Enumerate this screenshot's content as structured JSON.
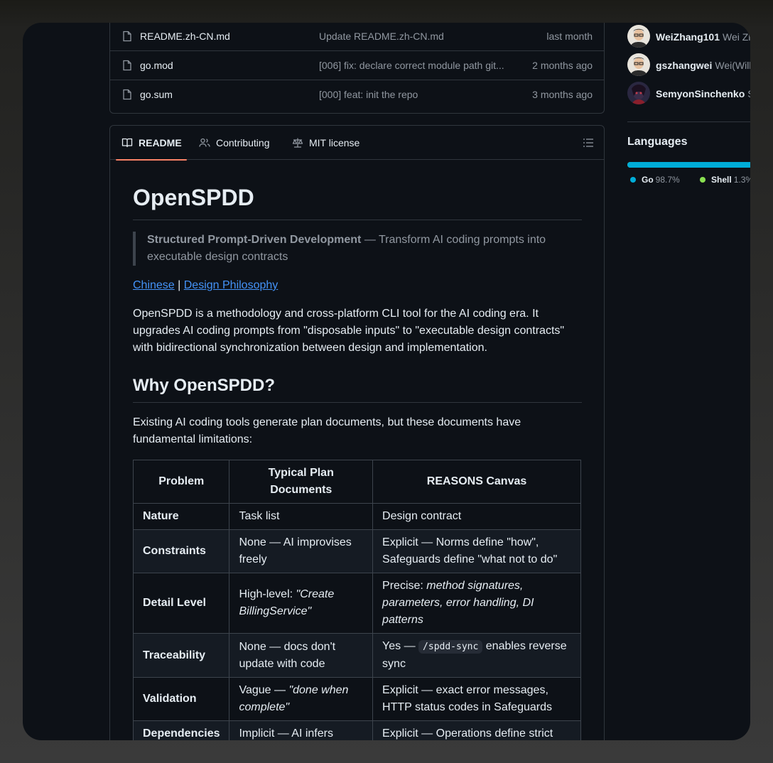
{
  "files": [
    {
      "name": "README.zh-CN.md",
      "message": "Update README.zh-CN.md",
      "date": "last month"
    },
    {
      "name": "go.mod",
      "message": "[006] fix: declare correct module path git...",
      "date": "2 months ago"
    },
    {
      "name": "go.sum",
      "message": "[000] feat: init the repo",
      "date": "3 months ago"
    }
  ],
  "readme_tabs": {
    "readme": "README",
    "contributing": "Contributing",
    "license": "MIT license"
  },
  "readme": {
    "title": "OpenSPDD",
    "quote_strong": "Structured Prompt-Driven Development",
    "quote_rest": " — Transform AI coding prompts into executable design contracts",
    "link_chinese": "Chinese",
    "link_sep": " | ",
    "link_philosophy": "Design Philosophy",
    "intro": "OpenSPDD is a methodology and cross-platform CLI tool for the AI coding era. It upgrades AI coding prompts from \"disposable inputs\" to \"executable design contracts\" with bidirectional synchronization between design and implementation.",
    "why_heading": "Why OpenSPDD?",
    "why_text": "Existing AI coding tools generate plan documents, but these documents have fundamental limitations:",
    "table": {
      "headers": [
        "Problem",
        "Typical Plan Documents",
        "REASONS Canvas"
      ],
      "rows": [
        {
          "problem": "Nature",
          "typical": "Task list",
          "typical_em": "",
          "canvas_pre": "Design contract",
          "canvas_em": "",
          "canvas_code": "",
          "canvas_post": ""
        },
        {
          "problem": "Constraints",
          "typical": "None — AI improvises freely",
          "typical_em": "",
          "canvas_pre": "Explicit — Norms define \"how\", Safeguards define \"what not to do\"",
          "canvas_em": "",
          "canvas_code": "",
          "canvas_post": ""
        },
        {
          "problem": "Detail Level",
          "typical": "High-level: ",
          "typical_em": "\"Create BillingService\"",
          "canvas_pre": "Precise: ",
          "canvas_em": "method signatures, parameters, error handling, DI patterns",
          "canvas_code": "",
          "canvas_post": ""
        },
        {
          "problem": "Traceability",
          "typical": "None — docs don't update with code",
          "typical_em": "",
          "canvas_pre": "Yes — ",
          "canvas_em": "",
          "canvas_code": "/spdd-sync",
          "canvas_post": " enables reverse sync"
        },
        {
          "problem": "Validation",
          "typical": "Vague — ",
          "typical_em": "\"done when complete\"",
          "canvas_pre": "Explicit — exact error messages, HTTP status codes in Safeguards",
          "canvas_em": "",
          "canvas_code": "",
          "canvas_post": ""
        },
        {
          "problem": "Dependencies",
          "typical": "Implicit — AI infers",
          "typical_em": "",
          "canvas_pre": "Explicit — Operations define strict",
          "canvas_em": "",
          "canvas_code": "",
          "canvas_post": ""
        }
      ]
    }
  },
  "sidebar": {
    "contributors": [
      {
        "login": "WeiZhang101",
        "fullname": "Wei Zh"
      },
      {
        "login": "gszhangwei",
        "fullname": "Wei(Will"
      },
      {
        "login": "SemyonSinchenko",
        "fullname": "S"
      }
    ],
    "languages_title": "Languages",
    "languages": [
      {
        "name": "Go",
        "percent": "98.7%",
        "fraction": 0.987,
        "color": "#00add8"
      },
      {
        "name": "Shell",
        "percent": "1.3%",
        "fraction": 0.013,
        "color": "#89e051"
      }
    ]
  }
}
